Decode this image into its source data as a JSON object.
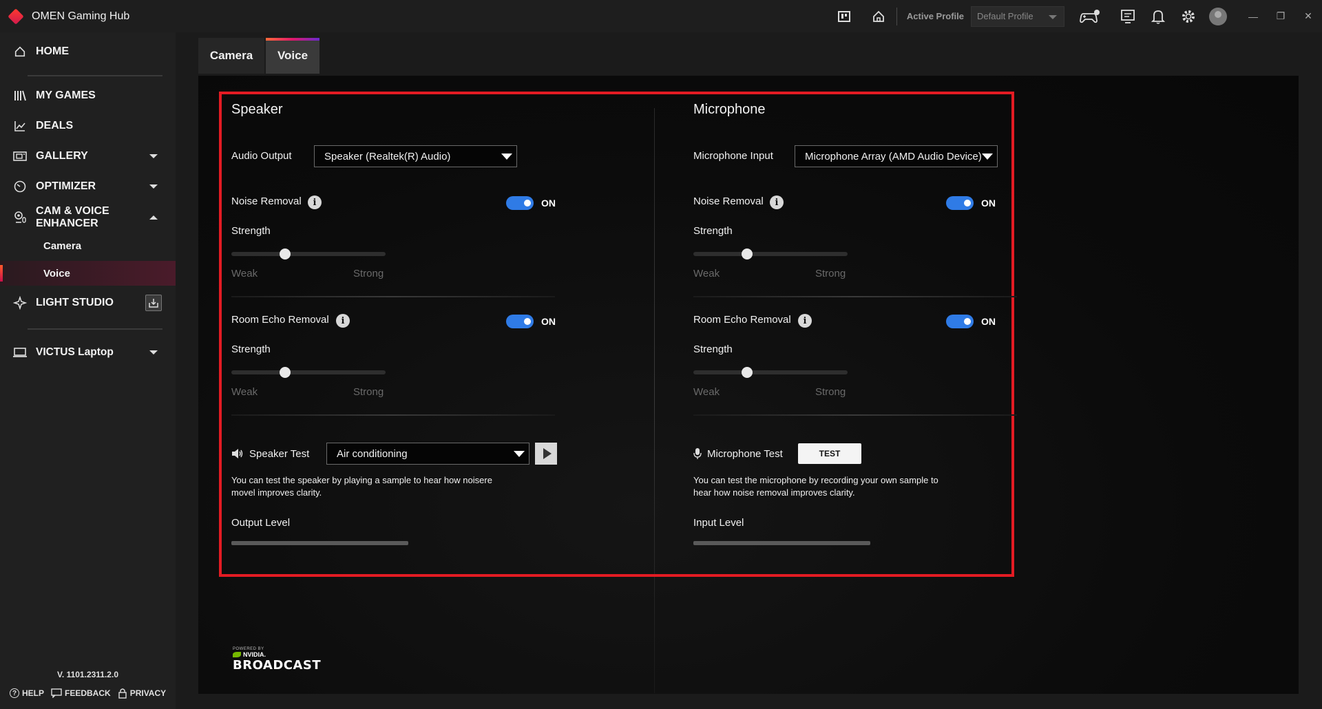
{
  "titlebar": {
    "app_title": "OMEN Gaming Hub",
    "active_profile_label": "Active Profile",
    "profile_value": "Default Profile",
    "icons": [
      "library-icon",
      "home-icon",
      "controller-icon",
      "feedback-screen-icon",
      "bell-icon",
      "gear-icon",
      "avatar-icon"
    ],
    "window_controls": [
      "minimize",
      "restore",
      "close"
    ]
  },
  "sidebar": {
    "home": "HOME",
    "my_games": "MY GAMES",
    "deals": "DEALS",
    "gallery": "GALLERY",
    "optimizer": "OPTIMIZER",
    "cam_voice_line1": "CAM & VOICE",
    "cam_voice_line2": "ENHANCER",
    "camera": "Camera",
    "voice": "Voice",
    "light_studio": "LIGHT STUDIO",
    "device": "VICTUS Laptop",
    "version": "V. 1101.2311.2.0",
    "help": "HELP",
    "feedback": "FEEDBACK",
    "privacy": "PRIVACY"
  },
  "tabs": {
    "camera": "Camera",
    "voice": "Voice"
  },
  "speaker": {
    "title": "Speaker",
    "output_label": "Audio Output",
    "output_value": "Speaker (Realtek(R) Audio)",
    "noise_label": "Noise Removal",
    "noise_state": "ON",
    "strength_label": "Strength",
    "weak": "Weak",
    "strong": "Strong",
    "noise_strength": 0.35,
    "echo_label": "Room Echo Removal",
    "echo_state": "ON",
    "echo_strength": 0.35,
    "test_label": "Speaker Test",
    "test_value": "Air conditioning",
    "desc_line1": "You can test the speaker by playing a sample to hear how noisere",
    "desc_line2": "movel improves clarity.",
    "level_label": "Output Level"
  },
  "microphone": {
    "title": "Microphone",
    "input_label": "Microphone Input",
    "input_value": "Microphone Array (AMD Audio Device)",
    "noise_label": "Noise Removal",
    "noise_state": "ON",
    "strength_label": "Strength",
    "weak": "Weak",
    "strong": "Strong",
    "noise_strength": 0.35,
    "echo_label": "Room Echo Removal",
    "echo_state": "ON",
    "echo_strength": 0.35,
    "test_label": "Microphone Test",
    "test_button": "TEST",
    "desc_line1": "You can test the microphone by recording your own sample to",
    "desc_line2": "hear how noise removal improves clarity.",
    "level_label": "Input Level"
  },
  "branding": {
    "powered_by": "POWERED BY",
    "nvidia": "NVIDIA.",
    "broadcast": "BROADCAST"
  },
  "colors": {
    "accent_toggle": "#2f7be6",
    "highlight_border": "#e31b23",
    "active_gradient_start": "#ff5a2a",
    "active_gradient_end": "#c8104a"
  }
}
